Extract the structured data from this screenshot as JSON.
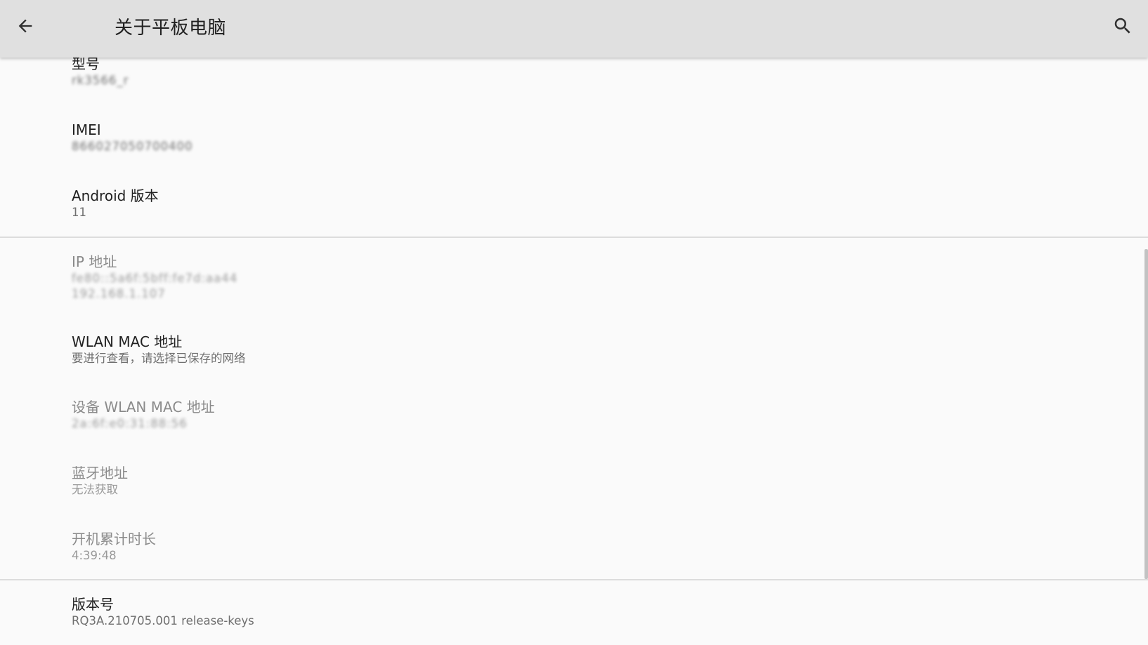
{
  "appbar": {
    "title": "关于平板电脑",
    "back_icon": "arrow-back-icon",
    "search_icon": "search-icon"
  },
  "prefs": {
    "model": {
      "title": "型号",
      "summary": "rk3566_r"
    },
    "imei": {
      "title": "IMEI",
      "summary": "866027050700400"
    },
    "android_version": {
      "title": "Android 版本",
      "summary": "11"
    },
    "ip_address": {
      "title": "IP 地址",
      "summary_line1": "fe80::5a6f:5bff:fe7d:aa44",
      "summary_line2": "192.168.1.107"
    },
    "wlan_mac": {
      "title": "WLAN MAC 地址",
      "summary": "要进行查看，请选择已保存的网络"
    },
    "device_wlan_mac": {
      "title": "设备 WLAN MAC 地址",
      "summary": "2a:6f:e0:31:88:56"
    },
    "bluetooth_address": {
      "title": "蓝牙地址",
      "summary": "无法获取"
    },
    "uptime": {
      "title": "开机累计时长",
      "summary": "4:39:48"
    },
    "build_number": {
      "title": "版本号",
      "summary": "RQ3A.210705.001 release-keys"
    }
  },
  "colors": {
    "appbar_bg": "#e0e0e0",
    "page_bg": "#fafafa",
    "divider": "#dcdcdc"
  }
}
